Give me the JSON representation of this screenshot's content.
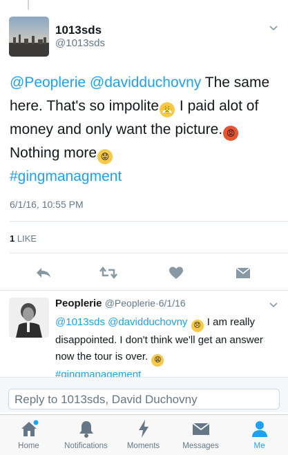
{
  "tweet": {
    "author_name": "1013sds",
    "author_handle": "@1013sds",
    "mention1": "@Peoplerie",
    "mention2": "@davidduchovny",
    "text_part1": "The same here. That's so impolite",
    "text_part2": "I paid alot of money and only want the picture.",
    "text_part3": "Nothing more",
    "hashtag": "#gingmanagment",
    "timestamp": "6/1/16, 10:55 PM",
    "likes_count": "1",
    "likes_label": "LIKE"
  },
  "reply": {
    "author_name": "Peoplerie",
    "author_handle": "@Peoplerie",
    "separator": "·",
    "date": "6/1/16",
    "mention1": "@1013sds",
    "mention2": "@davidduchovny",
    "text_part1": "I am really disappointed. I don't think we'll get an answer now the tour is over.",
    "hashtag": "#gingmanagement"
  },
  "composer": {
    "placeholder": "Reply to 1013sds, David Duchovny"
  },
  "tabs": [
    {
      "label": "Home"
    },
    {
      "label": "Notifications"
    },
    {
      "label": "Moments"
    },
    {
      "label": "Messages"
    },
    {
      "label": "Me"
    }
  ],
  "colors": {
    "accent": "#1da1f2",
    "secondary_text": "#657786",
    "icon_gray": "#657786"
  }
}
